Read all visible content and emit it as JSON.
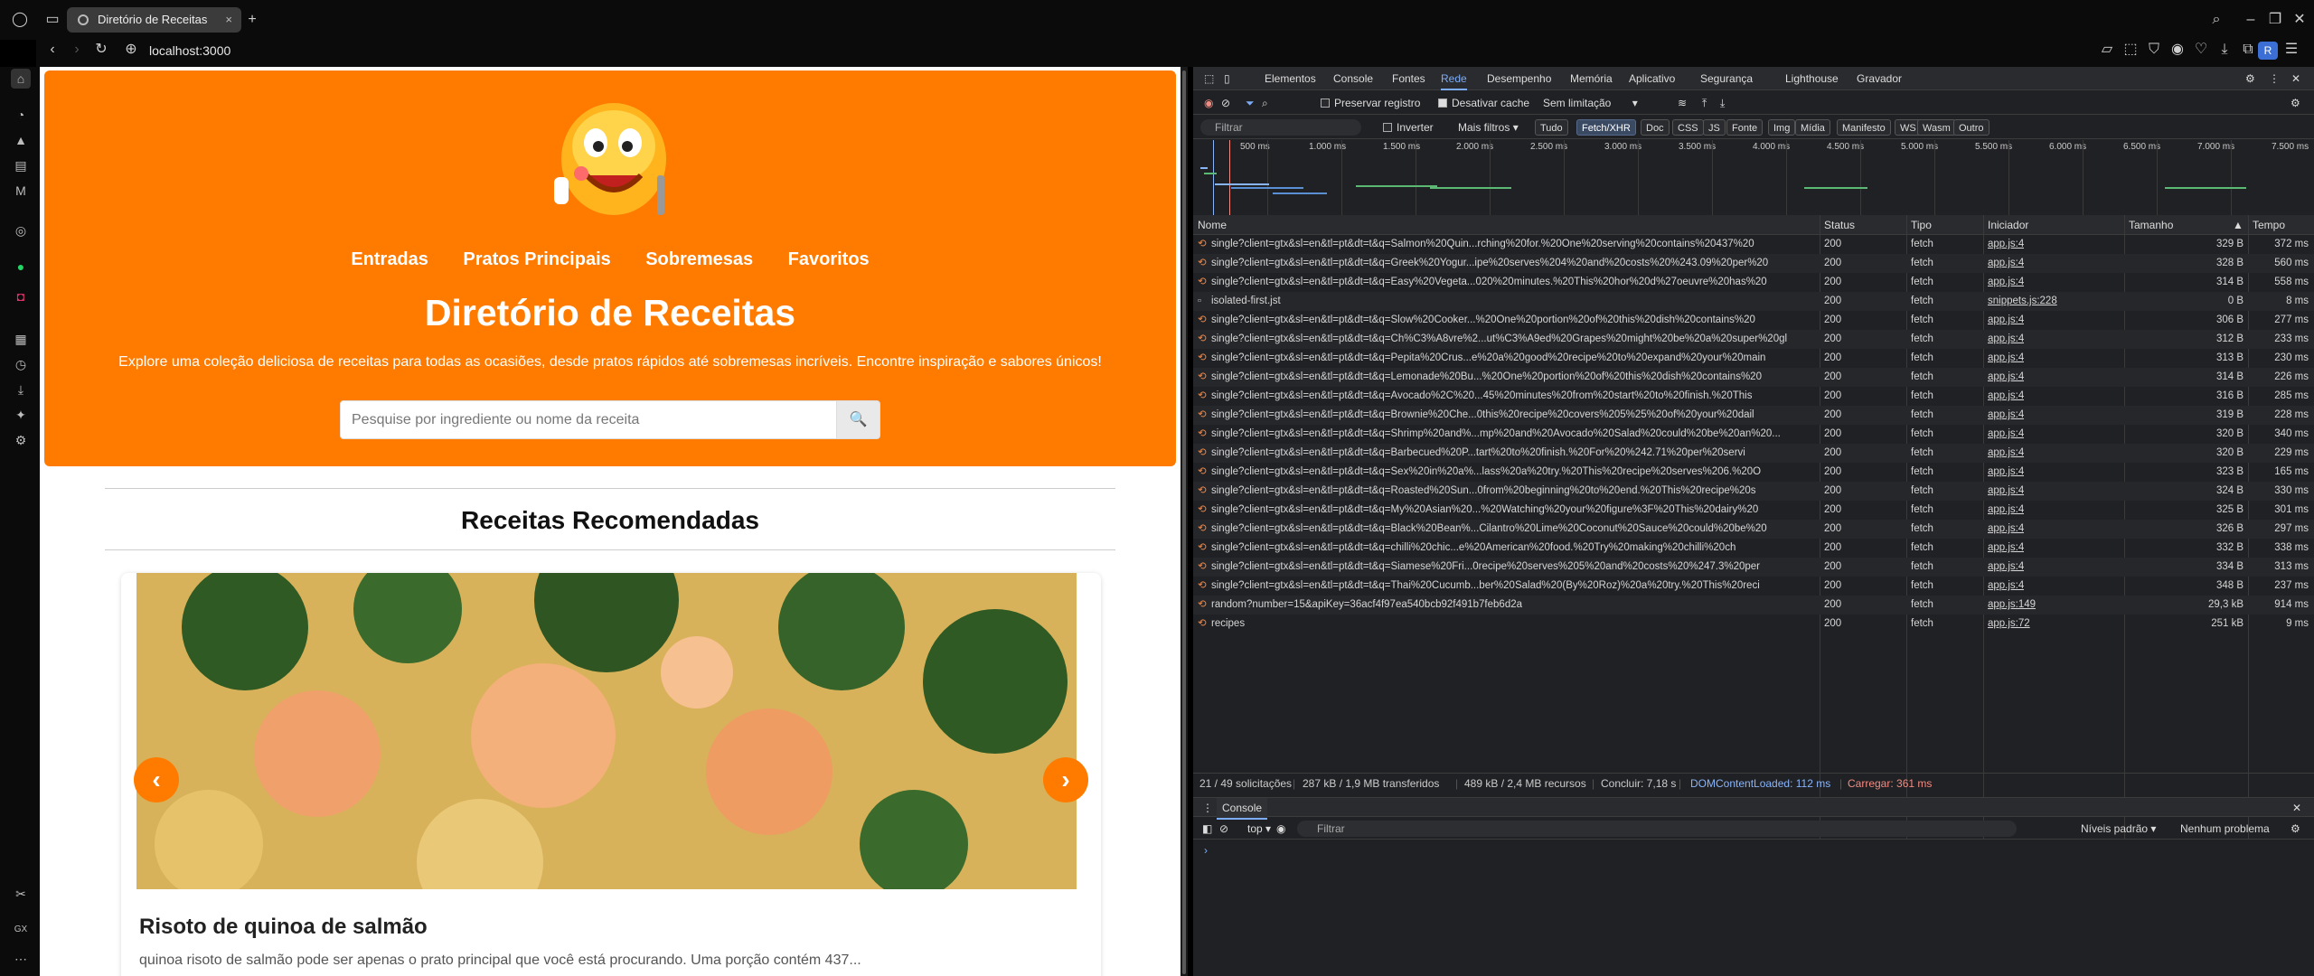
{
  "browser": {
    "tab_title": "Diretório de Receitas",
    "tab_close": "×",
    "new_tab": "+",
    "address": "localhost:3000",
    "profile_initial": "R"
  },
  "page": {
    "nav": [
      "Entradas",
      "Pratos Principais",
      "Sobremesas",
      "Favoritos"
    ],
    "title": "Diretório de Receitas",
    "subtitle": "Explore uma coleção deliciosa de receitas para todas as ocasiões, desde pratos rápidos até sobremesas incríveis. Encontre inspiração e sabores únicos!",
    "search_placeholder": "Pesquise por ingrediente ou nome da receita",
    "section_title": "Receitas Recomendadas",
    "card": {
      "title": "Risoto de quinoa de salmão",
      "desc": "quinoa risoto de salmão pode ser apenas o prato principal que você está procurando. Uma porção contém 437..."
    },
    "prev_label": "‹",
    "next_label": "›"
  },
  "devtools": {
    "tabs": [
      "Elementos",
      "Console",
      "Fontes",
      "Rede",
      "Desempenho",
      "Memória",
      "Aplicativo",
      "Segurança",
      "Lighthouse",
      "Gravador"
    ],
    "active_tab": "Rede",
    "preserve_log": "Preservar registro",
    "disable_cache": "Desativar cache",
    "throttle": "Sem limitação",
    "filter_placeholder": "Filtrar",
    "invert": "Inverter",
    "more_filters": "Mais filtros",
    "type_filters": [
      "Tudo",
      "Fetch/XHR",
      "Doc",
      "CSS",
      "JS",
      "Fonte",
      "Img",
      "Mídia",
      "Manifesto",
      "WS",
      "Wasm",
      "Outro"
    ],
    "active_type": "Fetch/XHR",
    "timeline_ticks": [
      "500 ms",
      "1.000 ms",
      "1.500 ms",
      "2.000 ms",
      "2.500 ms",
      "3.000 ms",
      "3.500 ms",
      "4.000 ms",
      "4.500 ms",
      "5.000 ms",
      "5.500 ms",
      "6.000 ms",
      "6.500 ms",
      "7.000 ms",
      "7.500 ms"
    ],
    "columns": [
      "Nome",
      "Status",
      "Tipo",
      "Iniciador",
      "Tamanho",
      "Tempo"
    ],
    "rows": [
      {
        "name": "single?client=gtx&sl=en&tl=pt&dt=t&q=Salmon%20Quin...rching%20for.%20One%20serving%20contains%20437%20",
        "status": "200",
        "type": "fetch",
        "initiator": "app.js:4",
        "size": "329 B",
        "time": "372 ms"
      },
      {
        "name": "single?client=gtx&sl=en&tl=pt&dt=t&q=Greek%20Yogur...ipe%20serves%204%20and%20costs%20%243.09%20per%20",
        "status": "200",
        "type": "fetch",
        "initiator": "app.js:4",
        "size": "328 B",
        "time": "560 ms"
      },
      {
        "name": "single?client=gtx&sl=en&tl=pt&dt=t&q=Easy%20Vegeta...020%20minutes.%20This%20hor%20d%27oeuvre%20has%20",
        "status": "200",
        "type": "fetch",
        "initiator": "app.js:4",
        "size": "314 B",
        "time": "558 ms"
      },
      {
        "name": "isolated-first.jst",
        "status": "200",
        "type": "fetch",
        "initiator": "snippets.js:228",
        "size": "0 B",
        "time": "8 ms"
      },
      {
        "name": "single?client=gtx&sl=en&tl=pt&dt=t&q=Slow%20Cooker...%20One%20portion%20of%20this%20dish%20contains%20",
        "status": "200",
        "type": "fetch",
        "initiator": "app.js:4",
        "size": "306 B",
        "time": "277 ms"
      },
      {
        "name": "single?client=gtx&sl=en&tl=pt&dt=t&q=Ch%C3%A8vre%2...ut%C3%A9ed%20Grapes%20might%20be%20a%20super%20gl",
        "status": "200",
        "type": "fetch",
        "initiator": "app.js:4",
        "size": "312 B",
        "time": "233 ms"
      },
      {
        "name": "single?client=gtx&sl=en&tl=pt&dt=t&q=Pepita%20Crus...e%20a%20good%20recipe%20to%20expand%20your%20main",
        "status": "200",
        "type": "fetch",
        "initiator": "app.js:4",
        "size": "313 B",
        "time": "230 ms"
      },
      {
        "name": "single?client=gtx&sl=en&tl=pt&dt=t&q=Lemonade%20Bu...%20One%20portion%20of%20this%20dish%20contains%20",
        "status": "200",
        "type": "fetch",
        "initiator": "app.js:4",
        "size": "314 B",
        "time": "226 ms"
      },
      {
        "name": "single?client=gtx&sl=en&tl=pt&dt=t&q=Avocado%2C%20...45%20minutes%20from%20start%20to%20finish.%20This",
        "status": "200",
        "type": "fetch",
        "initiator": "app.js:4",
        "size": "316 B",
        "time": "285 ms"
      },
      {
        "name": "single?client=gtx&sl=en&tl=pt&dt=t&q=Brownie%20Che...0this%20recipe%20covers%205%25%20of%20your%20dail",
        "status": "200",
        "type": "fetch",
        "initiator": "app.js:4",
        "size": "319 B",
        "time": "228 ms"
      },
      {
        "name": "single?client=gtx&sl=en&tl=pt&dt=t&q=Shrimp%20and%...mp%20and%20Avocado%20Salad%20could%20be%20an%20...",
        "status": "200",
        "type": "fetch",
        "initiator": "app.js:4",
        "size": "320 B",
        "time": "340 ms"
      },
      {
        "name": "single?client=gtx&sl=en&tl=pt&dt=t&q=Barbecued%20P...tart%20to%20finish.%20For%20%242.71%20per%20servi",
        "status": "200",
        "type": "fetch",
        "initiator": "app.js:4",
        "size": "320 B",
        "time": "229 ms"
      },
      {
        "name": "single?client=gtx&sl=en&tl=pt&dt=t&q=Sex%20in%20a%...lass%20a%20try.%20This%20recipe%20serves%206.%20O",
        "status": "200",
        "type": "fetch",
        "initiator": "app.js:4",
        "size": "323 B",
        "time": "165 ms"
      },
      {
        "name": "single?client=gtx&sl=en&tl=pt&dt=t&q=Roasted%20Sun...0from%20beginning%20to%20end.%20This%20recipe%20s",
        "status": "200",
        "type": "fetch",
        "initiator": "app.js:4",
        "size": "324 B",
        "time": "330 ms"
      },
      {
        "name": "single?client=gtx&sl=en&tl=pt&dt=t&q=My%20Asian%20...%20Watching%20your%20figure%3F%20This%20dairy%20",
        "status": "200",
        "type": "fetch",
        "initiator": "app.js:4",
        "size": "325 B",
        "time": "301 ms"
      },
      {
        "name": "single?client=gtx&sl=en&tl=pt&dt=t&q=Black%20Bean%...Cilantro%20Lime%20Coconut%20Sauce%20could%20be%20",
        "status": "200",
        "type": "fetch",
        "initiator": "app.js:4",
        "size": "326 B",
        "time": "297 ms"
      },
      {
        "name": "single?client=gtx&sl=en&tl=pt&dt=t&q=chilli%20chic...e%20American%20food.%20Try%20making%20chilli%20ch",
        "status": "200",
        "type": "fetch",
        "initiator": "app.js:4",
        "size": "332 B",
        "time": "338 ms"
      },
      {
        "name": "single?client=gtx&sl=en&tl=pt&dt=t&q=Siamese%20Fri...0recipe%20serves%205%20and%20costs%20%247.3%20per",
        "status": "200",
        "type": "fetch",
        "initiator": "app.js:4",
        "size": "334 B",
        "time": "313 ms"
      },
      {
        "name": "single?client=gtx&sl=en&tl=pt&dt=t&q=Thai%20Cucumb...ber%20Salad%20(By%20Roz)%20a%20try.%20This%20reci",
        "status": "200",
        "type": "fetch",
        "initiator": "app.js:4",
        "size": "348 B",
        "time": "237 ms"
      },
      {
        "name": "random?number=15&apiKey=36acf4f97ea540bcb92f491b7feb6d2a",
        "status": "200",
        "type": "fetch",
        "initiator": "app.js:149",
        "size": "29,3 kB",
        "time": "914 ms"
      },
      {
        "name": "recipes",
        "status": "200",
        "type": "fetch",
        "initiator": "app.js:72",
        "size": "251 kB",
        "time": "9 ms"
      }
    ],
    "summary": {
      "requests": "21 / 49 solicitações",
      "transferred": "287 kB / 1,9 MB transferidos",
      "resources": "489 kB / 2,4 MB recursos",
      "finish": "Concluir: 7,18 s",
      "dcl": "DOMContentLoaded: 112 ms",
      "load": "Carregar: 361 ms"
    },
    "drawer_tab": "Console",
    "console_context": "top",
    "console_filter": "Filtrar",
    "levels": "Níveis padrão",
    "issues": "Nenhum problema",
    "prompt": "›"
  },
  "colors": {
    "accent": "#ff7b00",
    "devtools_bg": "#202124",
    "devtools_active": "#7cacf8",
    "load_red": "#f28b82",
    "dcl_blue": "#8ab4f8"
  }
}
